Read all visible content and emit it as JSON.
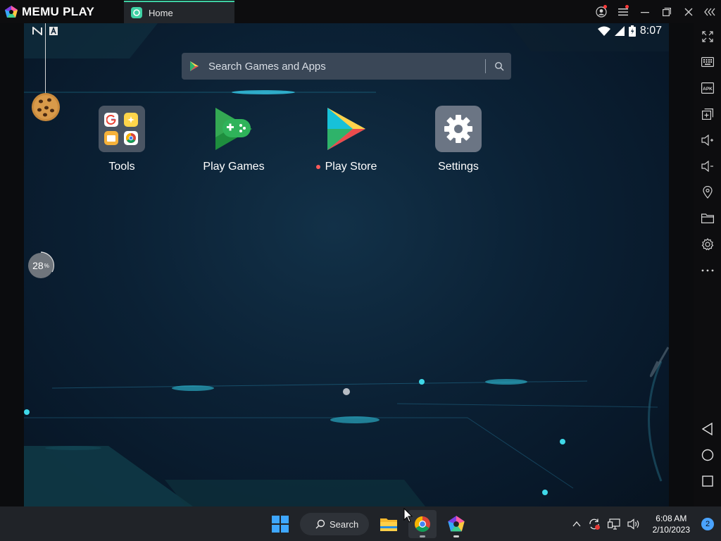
{
  "titlebar": {
    "brand": "MEMU PLAY",
    "tab_label": "Home"
  },
  "android": {
    "status": {
      "time": "8:07"
    },
    "search": {
      "placeholder": "Search Games and Apps"
    },
    "apps": [
      {
        "label": "Tools"
      },
      {
        "label": "Play Games"
      },
      {
        "label": "Play Store",
        "has_notification": true
      },
      {
        "label": "Settings"
      }
    ],
    "progress_widget": {
      "value": "28",
      "unit": "%"
    }
  },
  "sidebar": {
    "buttons": [
      "fullscreen",
      "keyboard",
      "apk",
      "multi-window",
      "volume-up",
      "volume-down",
      "location",
      "folder",
      "settings",
      "more",
      "back",
      "home",
      "recents"
    ]
  },
  "taskbar": {
    "search_label": "Search",
    "time": "6:08 AM",
    "date": "2/10/2023",
    "notification_count": "2"
  },
  "colors": {
    "tab_accent": "#3fd1a4",
    "taskbar": "#202328",
    "screen_bg": "#0b2135"
  }
}
